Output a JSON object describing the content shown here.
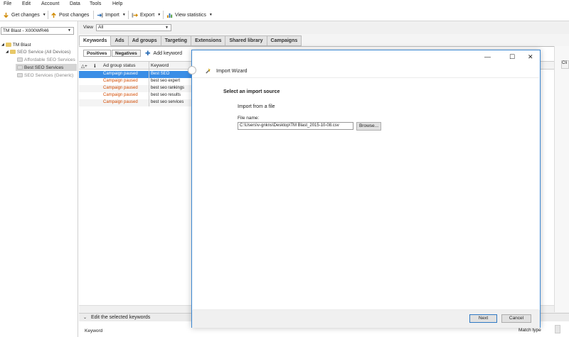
{
  "menu": [
    "File",
    "Edit",
    "Account",
    "Data",
    "Tools",
    "Help"
  ],
  "toolbar": {
    "get_changes": "Get changes",
    "post_changes": "Post changes",
    "import": "Import",
    "export": "Export",
    "view_statistics": "View statistics"
  },
  "left": {
    "account_select": "TM Blast - X000WR46",
    "tree": {
      "root": "TM Blast",
      "campaign": "SEO Service (All Devices)",
      "groups": [
        "Affordable SEO Services",
        "Best SEO Services",
        "SEO Services (Generic)"
      ]
    }
  },
  "main": {
    "view_label": "View",
    "view_value": "All",
    "tabs": [
      "Keywords",
      "Ads",
      "Ad groups",
      "Targeting",
      "Extensions",
      "Shared library",
      "Campaigns"
    ],
    "subtabs": [
      "Positives",
      "Negatives"
    ],
    "add_keyword": "Add keyword",
    "grid": {
      "sort_glyph": "△+",
      "info_glyph": "ℹ",
      "columns": [
        "Ad group status",
        "Keyword",
        "Cli"
      ],
      "rows": [
        {
          "status": "Campaign paused",
          "keyword": "Best SEO"
        },
        {
          "status": "Campaign paused",
          "keyword": "best seo expert"
        },
        {
          "status": "Campaign paused",
          "keyword": "best seo rankings"
        },
        {
          "status": "Campaign paused",
          "keyword": "best seo results"
        },
        {
          "status": "Campaign paused",
          "keyword": "best seo services"
        }
      ]
    },
    "edit_panel": "Edit the selected keywords",
    "edit_keyword_label": "Keyword",
    "match_type_label": "Match type"
  },
  "dialog": {
    "title": "Import Wizard",
    "heading": "Select an import source",
    "option": "Import from a file",
    "file_label": "File name:",
    "file_value": "C:\\Users\\v-gnkns\\Desktop\\TM Blast_2015-10-08.csv",
    "browse": "Browse...",
    "next": "Next",
    "cancel": "Cancel",
    "controls": {
      "minimize": "—",
      "maximize": "☐",
      "close": "✕"
    }
  },
  "colors": {
    "selection": "#3a8ee6",
    "status_paused": "#d24a00",
    "dialog_border": "#3c88d2"
  }
}
